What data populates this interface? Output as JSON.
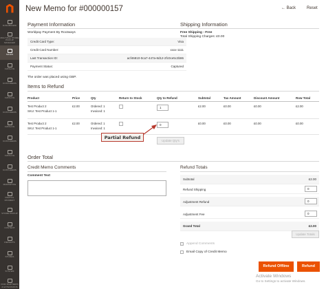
{
  "colors": {
    "accent": "#eb5202",
    "sidebar": "#373330",
    "sidebar_active": "#514943",
    "callout_border": "#b7382c"
  },
  "sidebar": {
    "items": [
      {
        "label": "DASHBOARD",
        "icon": "dashboard-icon"
      },
      {
        "label": "MULTIPLE STORE PICKUP MANAGER",
        "icon": "store-pickup-icon"
      },
      {
        "label": "SALES",
        "icon": "sales-icon",
        "active": true
      },
      {
        "label": "CATALOG",
        "icon": "catalog-icon"
      },
      {
        "label": "CUSTOMERS",
        "icon": "customers-icon"
      },
      {
        "label": "CATALOG",
        "icon": "catalog-icon"
      },
      {
        "label": "CUSTOMERS",
        "icon": "customers-icon"
      },
      {
        "label": "CATALOG",
        "icon": "catalog-icon"
      },
      {
        "label": "CUSTOMERS",
        "icon": "customers-icon"
      },
      {
        "label": "CATALOG",
        "icon": "catalog-icon"
      },
      {
        "label": "CUSTOMERS",
        "icon": "customers-icon"
      },
      {
        "label": "MARKETING",
        "icon": "marketing-icon"
      },
      {
        "label": "PARTIAL PAYMENT",
        "icon": "partial-payment-icon"
      },
      {
        "label": "STORE PICKUP",
        "icon": "store-pickup-icon"
      },
      {
        "label": "CONTENT",
        "icon": "content-icon"
      },
      {
        "label": "REPORTS",
        "icon": "reports-icon"
      },
      {
        "label": "STORES",
        "icon": "stores-icon"
      },
      {
        "label": "SYSTEM",
        "icon": "system-icon"
      },
      {
        "label": "FIND PARTNERS & EXTENSIONS",
        "icon": "extensions-icon"
      }
    ]
  },
  "header": {
    "title": "New Memo for #000000157",
    "back_label": "Back",
    "reset_label": "Reset"
  },
  "payment": {
    "title": "Payment Information",
    "method": "Worldpay Payment By Rootways",
    "rows": [
      {
        "label": "Credit Card Type:",
        "value": "Visa"
      },
      {
        "label": "Credit Card Number:",
        "value": "xxxx-1111"
      },
      {
        "label": "Last Transaction ID:",
        "value": "acf46810-0ca7-447a-8d12-2fc0ce5c3b86"
      },
      {
        "label": "Payment Status:",
        "value": "Captured"
      }
    ],
    "currency_note": "The order was placed using GBP."
  },
  "shipping": {
    "title": "Shipping Information",
    "method": "Free Shipping - Free",
    "charges": "Total Shipping Charges: £0.00"
  },
  "items": {
    "title": "Items to Refund",
    "headers": [
      "Product",
      "Price",
      "Qty",
      "Return to Stock",
      "Qty to Refund",
      "Subtotal",
      "Tax Amount",
      "Discount Amount",
      "Row Total"
    ],
    "rows": [
      {
        "product": "Test Product 2",
        "sku": "SKU: Test Product 1-1",
        "price": "£2.00",
        "ordered": "Ordered: 1",
        "invoiced": "Invoiced: 1",
        "qty_refund": "1",
        "subtotal": "£2.00",
        "tax": "£0.00",
        "discount": "£0.00",
        "row_total": "£2.00"
      },
      {
        "product": "Test Product 2",
        "sku": "SKU: Test Product 1-1",
        "price": "£2.00",
        "ordered": "Ordered: 1",
        "invoiced": "Invoiced: 1",
        "qty_refund": "0",
        "subtotal": "£0.00",
        "tax": "£0.00",
        "discount": "£0.00",
        "row_total": "£0.00"
      }
    ],
    "update_qty_label": "Update Qty's"
  },
  "callout": {
    "label": "Partial Refund"
  },
  "order_total": {
    "title": "Order Total",
    "comments_title": "Credit Memo Comments",
    "comment_label": "Comment Text",
    "totals_title": "Refund Totals",
    "rows": [
      {
        "label": "Subtotal",
        "value": "£2.00"
      },
      {
        "label": "Refund Shipping",
        "value": "0"
      },
      {
        "label": "Adjustment Refund",
        "value": "0"
      },
      {
        "label": "Adjustment Fee",
        "value": "0"
      },
      {
        "label": "Grand Total",
        "value": "£2.00"
      }
    ],
    "update_totals_label": "Update Totals",
    "append_comments_label": "Append Comments",
    "email_copy_label": "Email Copy of Credit Memo",
    "refund_offline_label": "Refund Offline",
    "refund_label": "Refund"
  },
  "watermark": {
    "line1": "Activate Windows",
    "line2": "Go to Settings to activate Windows."
  }
}
